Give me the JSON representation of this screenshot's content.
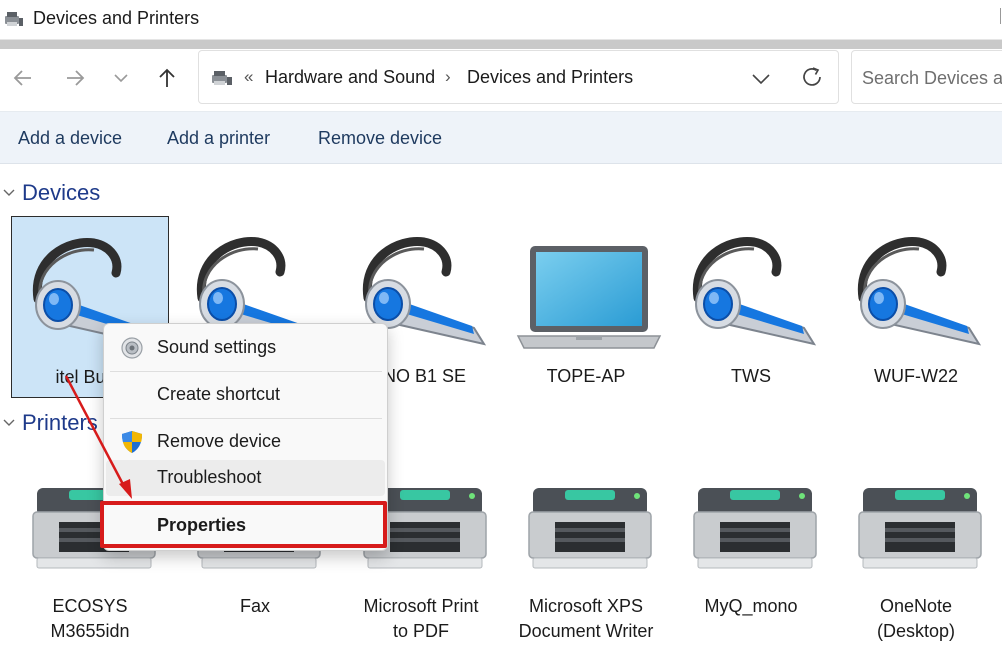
{
  "window": {
    "title": "Devices and Printers"
  },
  "address_bar": {
    "overflow_chevron": "«",
    "breadcrumbs": [
      "Hardware and Sound",
      "Devices and Printers"
    ],
    "separator": "›"
  },
  "search": {
    "placeholder": "Search Devices and Printers"
  },
  "commands": {
    "add_device": "Add a device",
    "add_printer": "Add a printer",
    "remove_device": "Remove device"
  },
  "groups": {
    "devices": "Devices",
    "printers": "Printers"
  },
  "devices": [
    {
      "label": "itel Buds",
      "icon": "headset-icon",
      "selected": true
    },
    {
      "label": "",
      "icon": "headset-icon",
      "selected": false
    },
    {
      "label": "CNO B1 SE",
      "icon": "headset-icon",
      "selected": false
    },
    {
      "label": "TOPE-AP",
      "icon": "laptop-icon",
      "selected": false
    },
    {
      "label": "TWS",
      "icon": "headset-icon",
      "selected": false
    },
    {
      "label": "WUF-W22",
      "icon": "headset-icon",
      "selected": false
    }
  ],
  "printers": [
    {
      "line1": "ECOSYS",
      "line2": "M3655idn"
    },
    {
      "line1": "Fax",
      "line2": ""
    },
    {
      "line1": "Microsoft Print",
      "line2": "to PDF"
    },
    {
      "line1": "Microsoft XPS",
      "line2": "Document Writer"
    },
    {
      "line1": "MyQ_mono",
      "line2": ""
    },
    {
      "line1": "OneNote",
      "line2": "(Desktop)"
    }
  ],
  "context_menu": {
    "sound_settings": "Sound settings",
    "create_shortcut": "Create shortcut",
    "remove_device": "Remove device",
    "troubleshoot": "Troubleshoot",
    "properties": "Properties"
  },
  "colors": {
    "accent_blue": "#1e3a8a",
    "selection": "#cce4f7",
    "annotation_red": "#d71b1b",
    "command_bar": "#eef3f9"
  }
}
